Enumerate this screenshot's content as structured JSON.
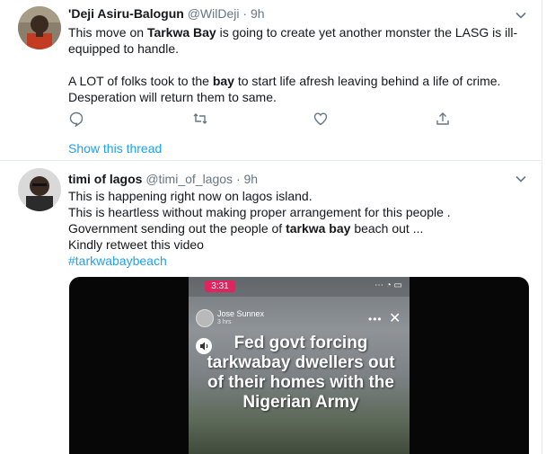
{
  "tweets": [
    {
      "name": "'Deji Asiru-Balogun",
      "handle": "@WilDeji",
      "sep": "·",
      "time": "9h",
      "body": {
        "line1": [
          "This move on ",
          "Tarkwa Bay",
          " is going to create yet another monster the LASG is ill-equipped to handle."
        ],
        "line2": [
          "A LOT of folks took to the ",
          "bay",
          " to start life afresh leaving behind a life of crime."
        ],
        "line3": "Desperation will return them to same."
      },
      "actions": [
        "reply-icon",
        "retweet-icon",
        "like-icon",
        "share-icon"
      ],
      "show_thread": "Show this thread"
    },
    {
      "name": "timi of lagos",
      "handle": "@timi_of_lagos",
      "sep": "·",
      "time": "9h",
      "body": {
        "l1": "This is happening right now on lagos island.",
        "l2": "This is heartless without making proper arrangement for this people .",
        "l3": [
          "Government sending out the people of ",
          "tarkwa bay",
          " beach out ..."
        ],
        "l4": "Kindly retweet this video",
        "hashtag": "#tarkwabaybeach"
      },
      "video": {
        "rec_time": "3:31",
        "status_icons": "⋯ ◔ ▭",
        "user": "Jose Sunnex",
        "user_sub": "3 hrs",
        "more": "•••",
        "close": "✕",
        "caption": "Fed govt forcing tarkwabay dwellers out of their homes with the Nigerian Army"
      }
    }
  ],
  "colors": {
    "accent": "#1da1f2",
    "muted": "#657786",
    "text": "#14171a",
    "border": "#e6ecf0"
  }
}
